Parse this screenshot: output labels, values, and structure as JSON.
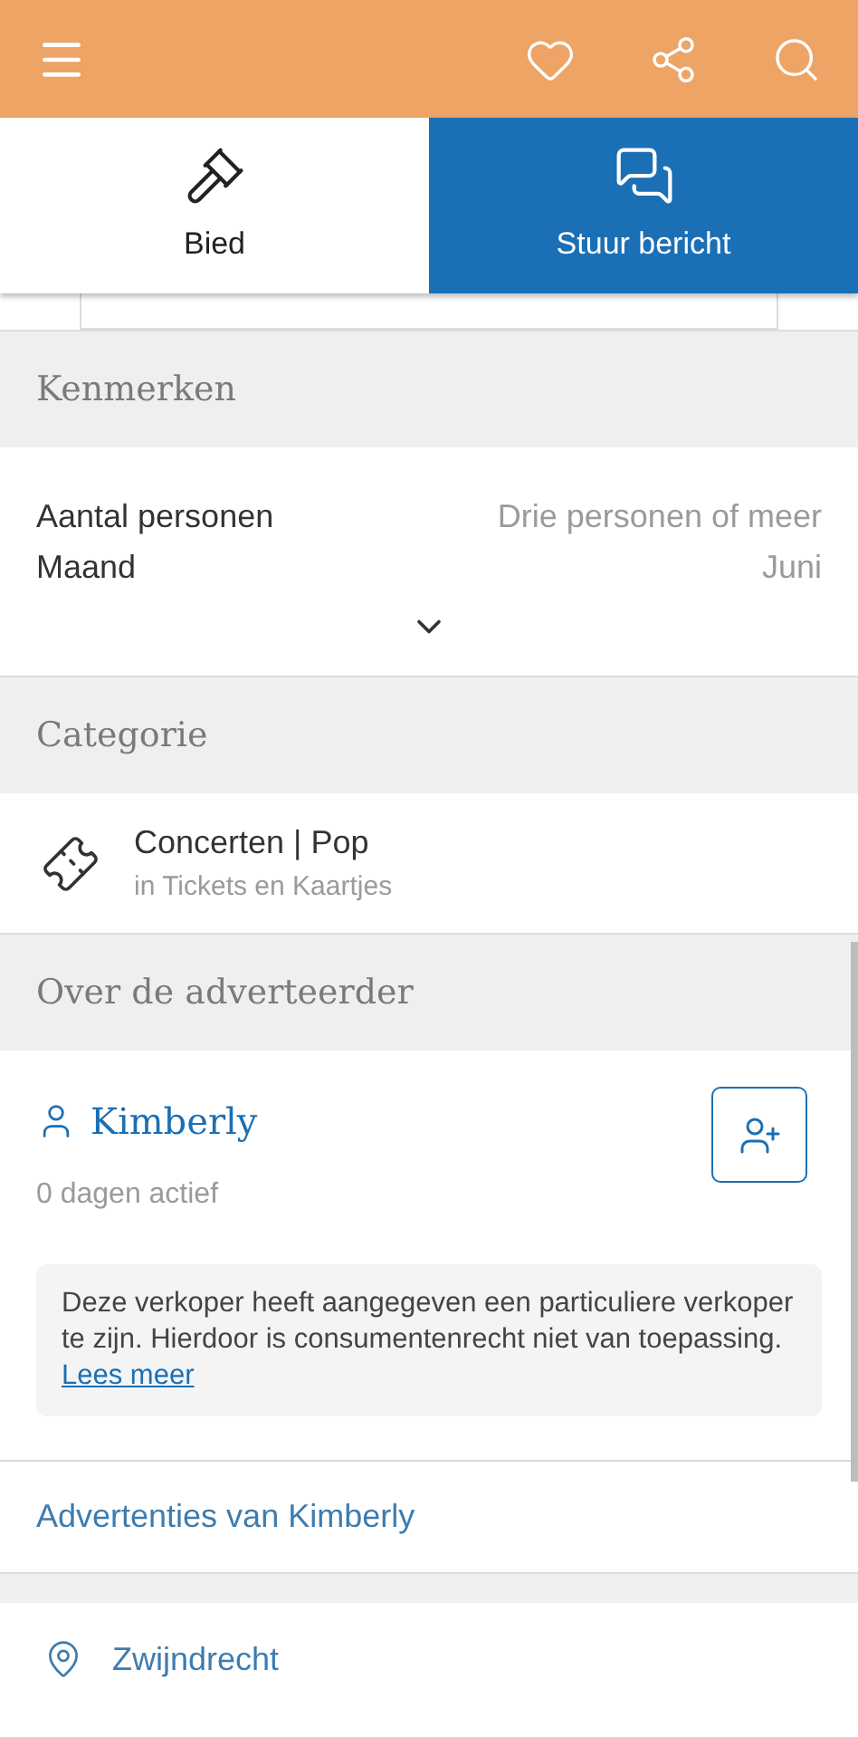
{
  "actions": [
    {
      "kind": "plain",
      "label": "Bied"
    },
    {
      "kind": "filled",
      "label": "Stuur bericht"
    }
  ],
  "features": {
    "title": "Kenmerken",
    "rows": [
      {
        "label": "Aantal personen",
        "value": "Drie personen of meer"
      },
      {
        "label": "Maand",
        "value": "Juni"
      }
    ],
    "expanded": false
  },
  "category": {
    "title": "Categorie",
    "name": "Concerten | Pop",
    "parent": "in Tickets en Kaartjes"
  },
  "advertiser": {
    "title": "Over de adverteerder",
    "name": "Kimberly",
    "active": "0 dagen actief",
    "notice": "Deze verkoper heeft aangegeven een particuliere verkoper te zijn. Hierdoor is consumentenrecht niet van toepassing.",
    "notice_link": "Lees meer"
  },
  "ads_link": "Advertenties van Kimberly",
  "location": "Zwijndrecht"
}
